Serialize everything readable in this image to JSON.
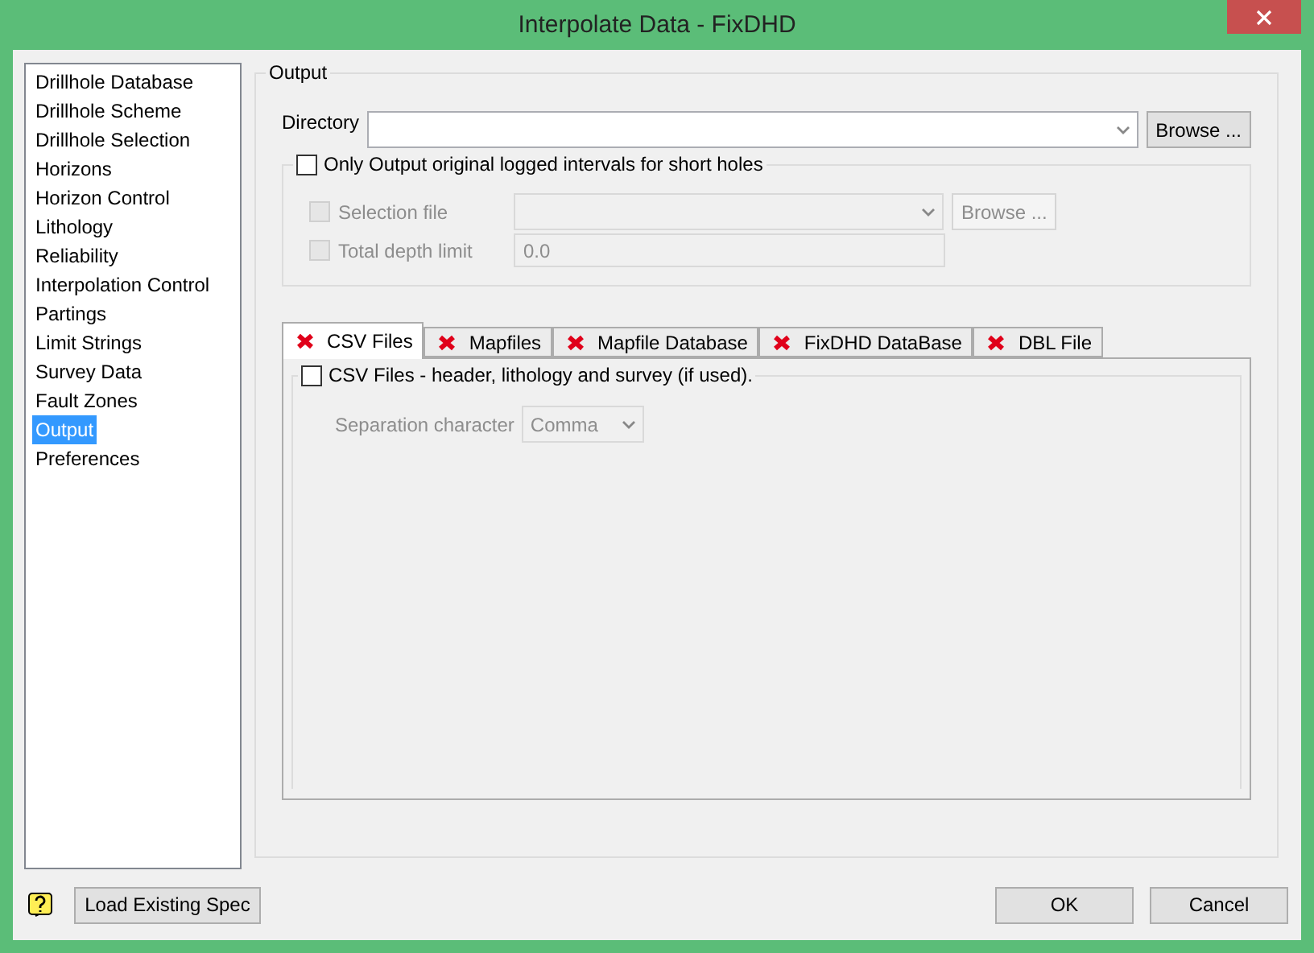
{
  "window": {
    "title": "Interpolate Data - FixDHD"
  },
  "sidebar": {
    "items": [
      {
        "label": "Drillhole Database",
        "selected": false
      },
      {
        "label": "Drillhole Scheme",
        "selected": false
      },
      {
        "label": "Drillhole Selection",
        "selected": false
      },
      {
        "label": "Horizons",
        "selected": false
      },
      {
        "label": "Horizon Control",
        "selected": false
      },
      {
        "label": "Lithology",
        "selected": false
      },
      {
        "label": "Reliability",
        "selected": false
      },
      {
        "label": "Interpolation Control",
        "selected": false
      },
      {
        "label": "Partings",
        "selected": false
      },
      {
        "label": "Limit Strings",
        "selected": false
      },
      {
        "label": "Survey Data",
        "selected": false
      },
      {
        "label": "Fault Zones",
        "selected": false
      },
      {
        "label": "Output",
        "selected": true
      },
      {
        "label": "Preferences",
        "selected": false
      }
    ]
  },
  "output": {
    "legend": "Output",
    "directory": {
      "label": "Directory",
      "browse": "Browse ..."
    },
    "short_holes": {
      "label": "Only Output original logged intervals for short holes",
      "checked": false,
      "selection_file": {
        "label": "Selection file",
        "checked": false,
        "disabled": true,
        "browse": "Browse ..."
      },
      "total_depth": {
        "label": "Total depth limit",
        "checked": false,
        "disabled": true,
        "value": "0.0"
      }
    }
  },
  "tabs": [
    {
      "label": "CSV Files",
      "selected": true
    },
    {
      "label": "Mapfiles",
      "selected": false
    },
    {
      "label": "Mapfile Database",
      "selected": false
    },
    {
      "label": "FixDHD DataBase",
      "selected": false
    },
    {
      "label": "DBL File",
      "selected": false
    }
  ],
  "csv_panel": {
    "label": "CSV Files - header, lithology and survey (if used).",
    "checked": false,
    "separation": {
      "label": "Separation character",
      "value": "Comma",
      "disabled": true
    }
  },
  "footer": {
    "load": "Load Existing Spec",
    "ok": "OK",
    "cancel": "Cancel"
  }
}
